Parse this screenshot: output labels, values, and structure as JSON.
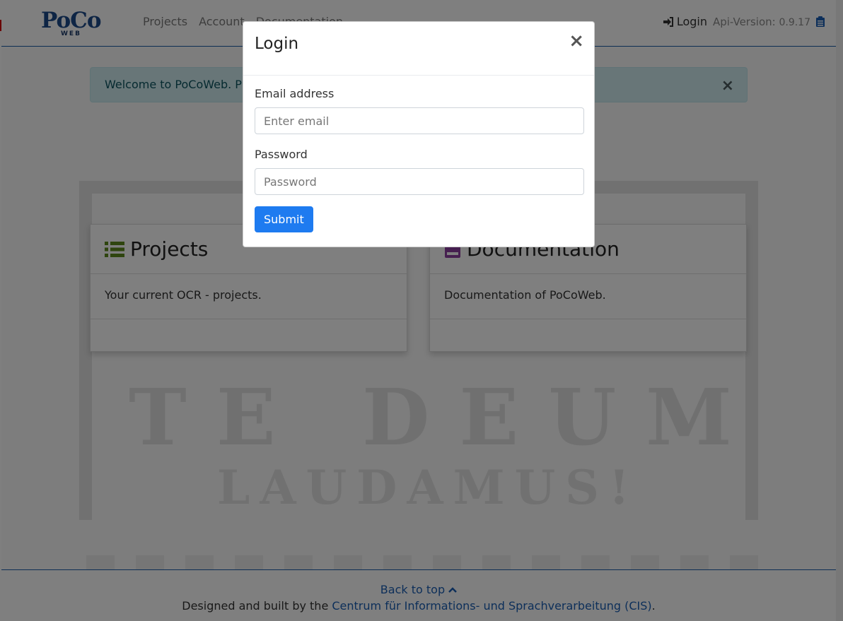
{
  "navbar": {
    "brand_main": "PoCo",
    "brand_sub": "WEB",
    "links": [
      "Projects",
      "Account",
      "Documentation"
    ],
    "login_label": "Login",
    "api_label": "Api-Version:",
    "api_version": "0.9.17"
  },
  "alert": {
    "text": "Welcome to PoCoWeb. Please login.",
    "close": "×"
  },
  "hero": {
    "line1": "TE DEUM",
    "line2": "LAUDAMUS!"
  },
  "cards": [
    {
      "title": "Projects",
      "icon": "list-icon",
      "text": "Your current OCR - projects."
    },
    {
      "title": "Documentation",
      "icon": "book-icon",
      "text": "Documentation of PoCoWeb."
    }
  ],
  "footer": {
    "back_to_top": "Back to top",
    "designed_prefix": "Designed and built by the ",
    "designed_link": "Centrum für Informations- und Sprachverarbeitung (CIS)",
    "designed_suffix": "."
  },
  "modal": {
    "title": "Login",
    "close": "×",
    "email_label": "Email address",
    "email_placeholder": "Enter email",
    "password_label": "Password",
    "password_placeholder": "Password",
    "submit_label": "Submit"
  },
  "colors": {
    "accent": "#1e7bf0",
    "nav_border": "#1a5aa8",
    "brand": "#1c4a8a",
    "alert_bg": "#d1ecf1",
    "list_icon": "#5e8a1e",
    "book_icon": "#8c3fa0"
  }
}
